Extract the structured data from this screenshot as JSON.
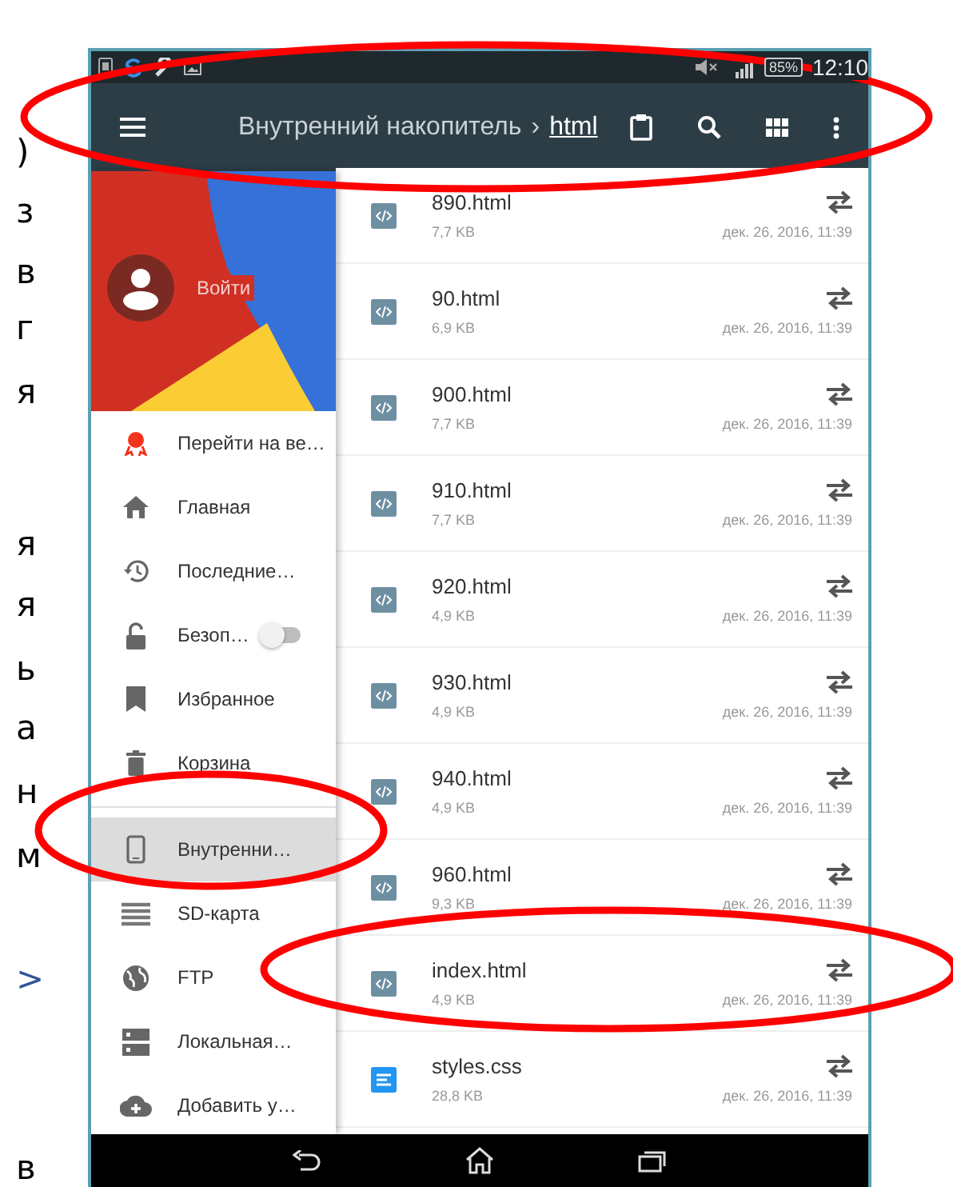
{
  "page_text": {
    "left": [
      {
        "text": ")",
        "color": "#000000"
      },
      {
        "text": "з",
        "color": "#000000"
      },
      {
        "text": "в",
        "color": "#000000"
      },
      {
        "text": "г",
        "color": "#000000"
      },
      {
        "text": "я",
        "color": "#000000"
      },
      {
        "text": "я",
        "color": "#000000"
      },
      {
        "text": "я",
        "color": "#000000"
      },
      {
        "text": "ь",
        "color": "#000000"
      },
      {
        "text": "а",
        "color": "#000000"
      },
      {
        "text": "н",
        "color": "#000000"
      },
      {
        "text": "м",
        "color": "#000000"
      },
      {
        "text": ">",
        "color": "#2f5597"
      },
      {
        "text": "в",
        "color": "#000000"
      }
    ]
  },
  "status_bar": {
    "battery": "85%",
    "time": "12:10"
  },
  "toolbar": {
    "path": "Внутренний накопитель",
    "separator": "›",
    "current": "html"
  },
  "drawer": {
    "account": "Войти",
    "items": [
      {
        "label": "Перейти на ве…",
        "kind": "link",
        "selected": false
      },
      {
        "label": "Главная",
        "kind": "link",
        "selected": false
      },
      {
        "label": "Последние…",
        "kind": "link",
        "selected": false
      },
      {
        "label": "Безоп…",
        "kind": "toggle",
        "on": false,
        "selected": false
      },
      {
        "label": "Избранное",
        "kind": "link",
        "selected": false
      },
      {
        "label": "Корзина",
        "kind": "link",
        "selected": false
      },
      {
        "label": "Внутренни…",
        "kind": "link",
        "selected": true
      },
      {
        "label": "SD-карта",
        "kind": "link",
        "selected": false
      },
      {
        "label": "FTP",
        "kind": "link",
        "selected": false
      },
      {
        "label": "Локальная…",
        "kind": "link",
        "selected": false
      },
      {
        "label": "Добавить у…",
        "kind": "link",
        "selected": false
      }
    ]
  },
  "files": [
    {
      "name": "890.html",
      "size": "7,7 KB",
      "date": "дек. 26, 2016, 11:39",
      "kind": "html"
    },
    {
      "name": "90.html",
      "size": "6,9 KB",
      "date": "дек. 26, 2016, 11:39",
      "kind": "html"
    },
    {
      "name": "900.html",
      "size": "7,7 KB",
      "date": "дек. 26, 2016, 11:39",
      "kind": "html"
    },
    {
      "name": "910.html",
      "size": "7,7 KB",
      "date": "дек. 26, 2016, 11:39",
      "kind": "html"
    },
    {
      "name": "920.html",
      "size": "4,9 KB",
      "date": "дек. 26, 2016, 11:39",
      "kind": "html"
    },
    {
      "name": "930.html",
      "size": "4,9 KB",
      "date": "дек. 26, 2016, 11:39",
      "kind": "html"
    },
    {
      "name": "940.html",
      "size": "4,9 KB",
      "date": "дек. 26, 2016, 11:39",
      "kind": "html"
    },
    {
      "name": "960.html",
      "size": "9,3 KB",
      "date": "дек. 26, 2016, 11:39",
      "kind": "html"
    },
    {
      "name": "index.html",
      "size": "4,9 KB",
      "date": "дек. 26, 2016, 11:39",
      "kind": "html"
    },
    {
      "name": "styles.css",
      "size": "28,8 KB",
      "date": "дек. 26, 2016, 11:39",
      "kind": "css"
    }
  ]
}
